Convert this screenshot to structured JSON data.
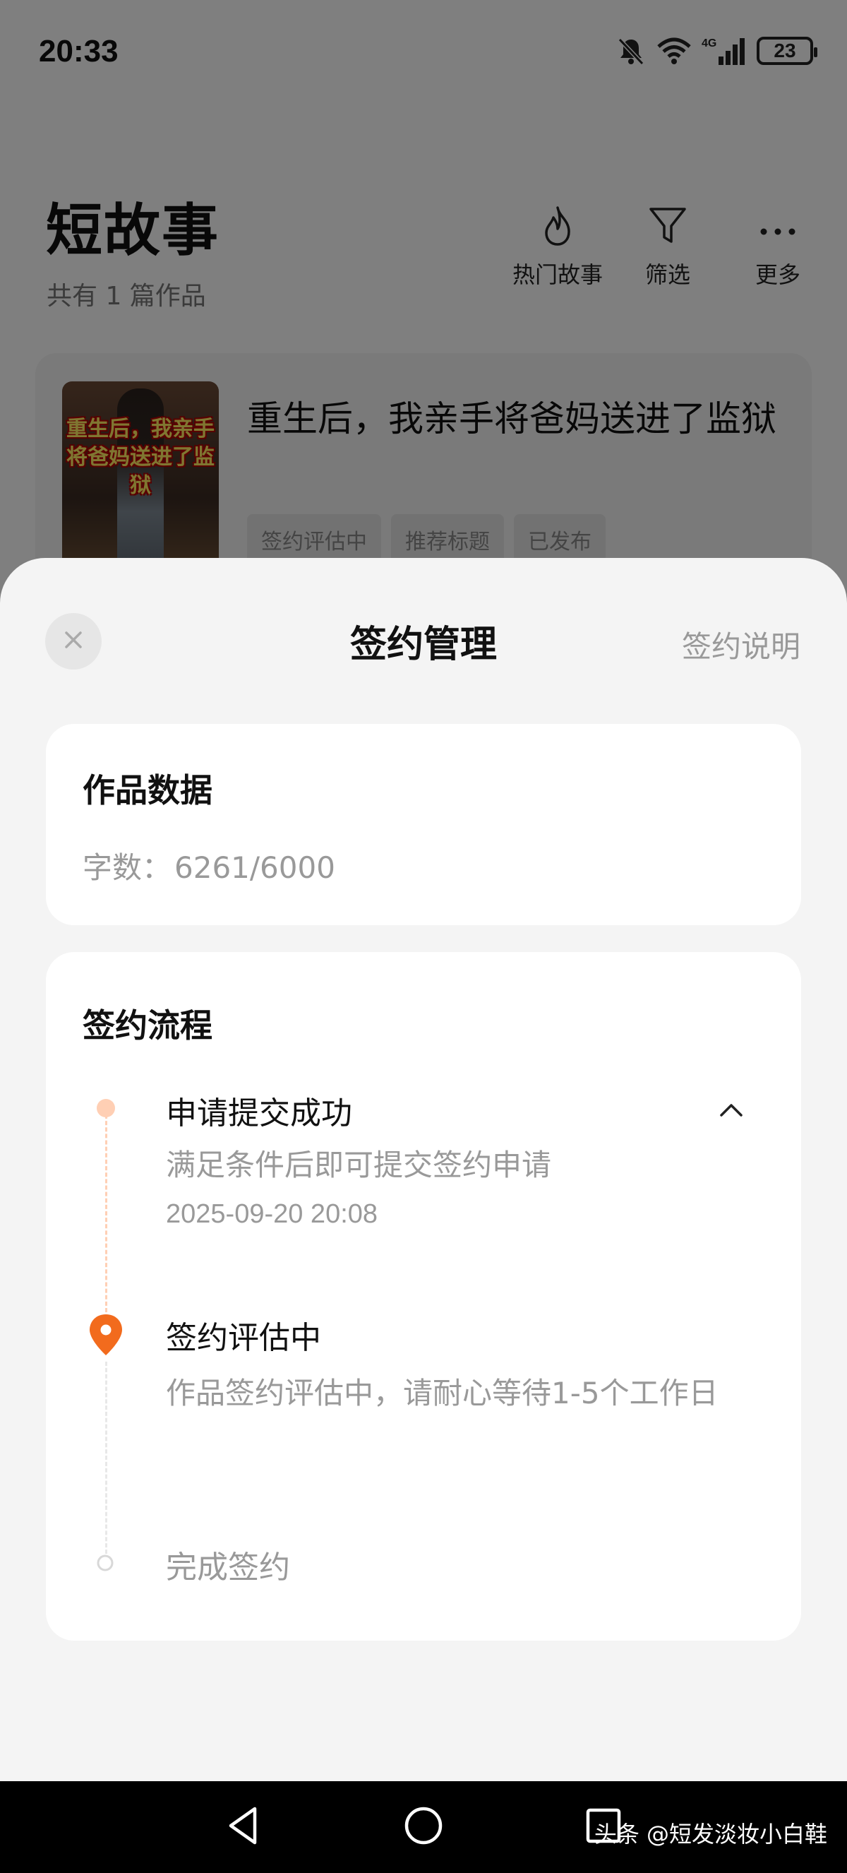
{
  "status_bar": {
    "time": "20:33",
    "network": "4G",
    "battery": "23"
  },
  "header": {
    "title": "短故事",
    "subtitle": "共有 1 篇作品",
    "actions": [
      {
        "label": "热门故事",
        "icon": "flame-icon"
      },
      {
        "label": "筛选",
        "icon": "filter-icon"
      },
      {
        "label": "更多",
        "icon": "more-dots-icon"
      }
    ]
  },
  "story": {
    "cover_text": "重生后，我亲手将爸妈送进了监狱",
    "title": "重生后，我亲手将爸妈送进了监狱",
    "tags": [
      "签约评估中",
      "推荐标题",
      "已发布"
    ]
  },
  "sheet": {
    "title": "签约管理",
    "help_link": "签约说明",
    "works_panel": {
      "heading": "作品数据",
      "wordcount_label": "字数：",
      "wordcount_value": "6261/6000"
    },
    "flow_panel": {
      "heading": "签约流程",
      "steps": [
        {
          "title": "申请提交成功",
          "desc": "满足条件后即可提交签约申请",
          "time": "2025-09-20 20:08",
          "state": "done"
        },
        {
          "title": "签约评估中",
          "desc": "作品签约评估中，请耐心等待1-5个工作日",
          "state": "current"
        },
        {
          "title": "完成签约",
          "state": "pending"
        }
      ]
    }
  },
  "navbar": {
    "watermark": "头条 @短发淡妆小白鞋"
  },
  "colors": {
    "accent": "#f26b1d",
    "accent_light": "#ffcfb4",
    "muted_text": "#999999",
    "sheet_bg": "#f4f4f4"
  }
}
